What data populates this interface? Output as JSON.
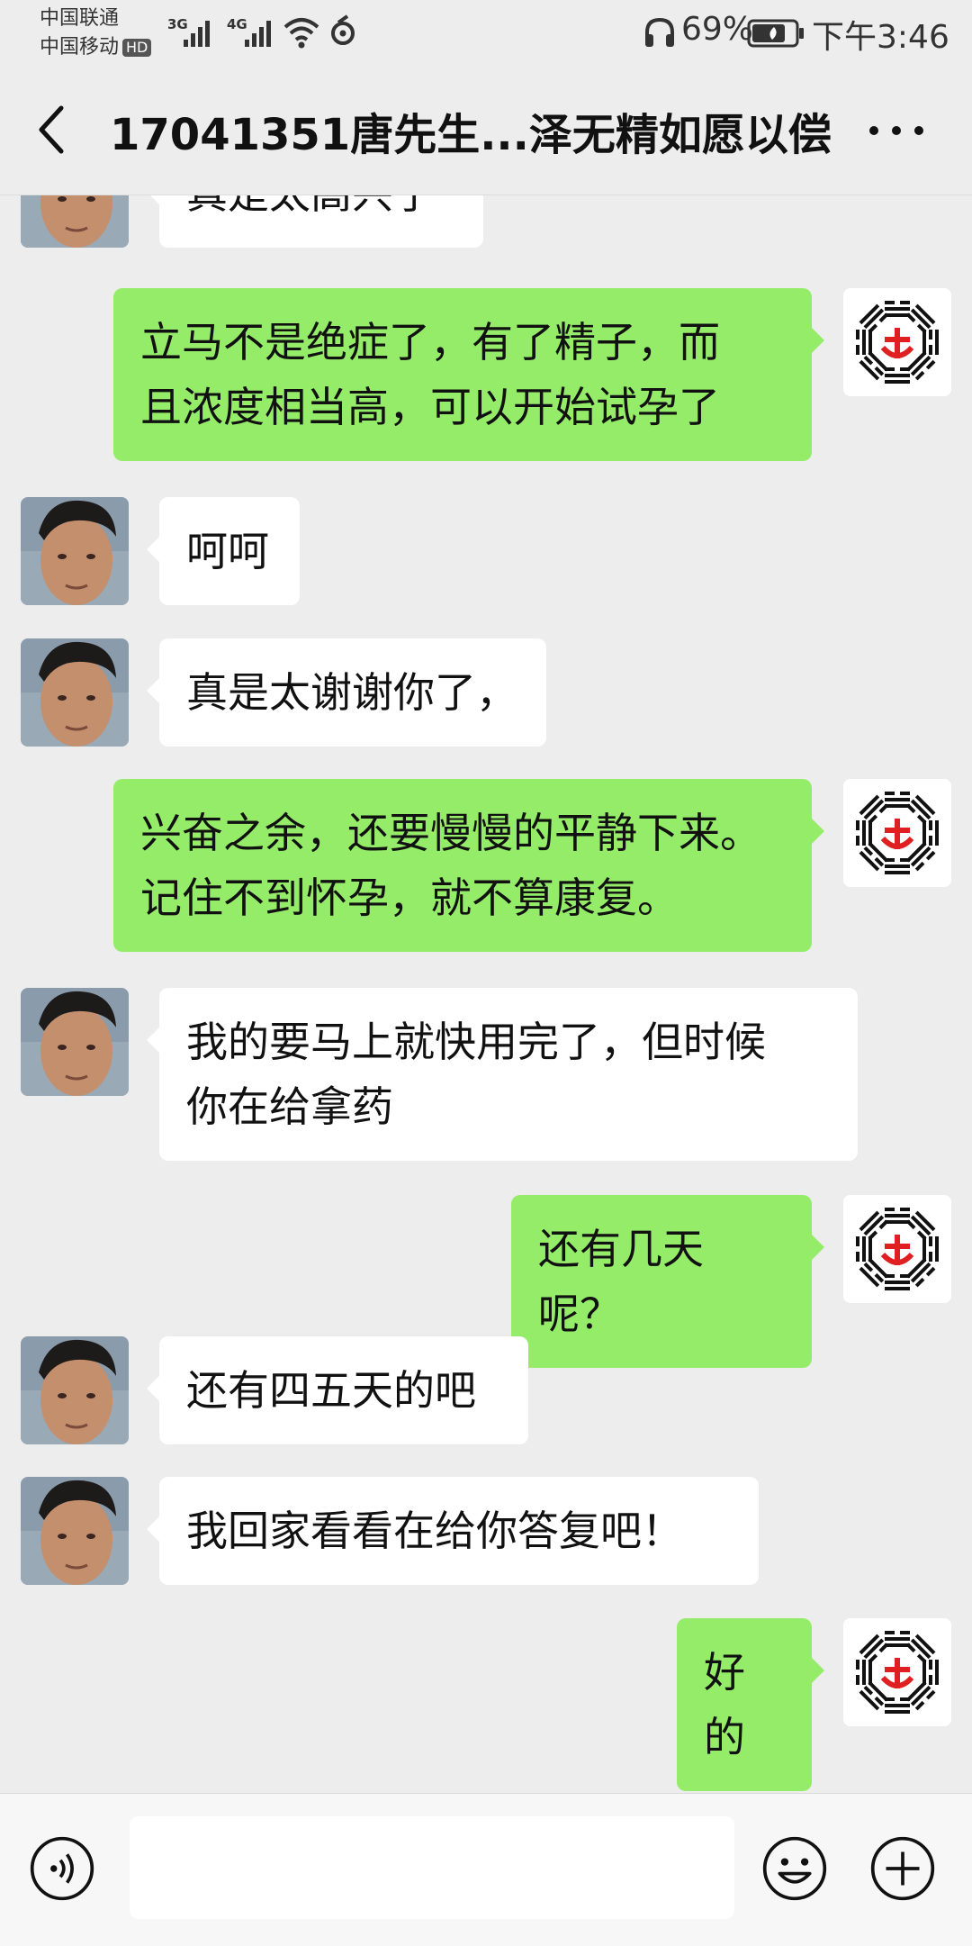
{
  "status_bar": {
    "carrier_1": "中国联通",
    "carrier_2": "中国移动",
    "hd_badge": "HD",
    "network_1": "3G",
    "network_2": "4G",
    "battery_percent": "69%",
    "time": "下午3:46"
  },
  "header": {
    "title": "17041351唐先生...泽无精如愿以偿"
  },
  "messages": [
    {
      "side": "left",
      "text": "真是太高兴了"
    },
    {
      "side": "right",
      "lines": [
        "立马不是绝症了，有了精子，而",
        "且浓度相当高，可以开始试孕了"
      ]
    },
    {
      "side": "left",
      "text": "呵呵"
    },
    {
      "side": "left",
      "text": "真是太谢谢你了，"
    },
    {
      "side": "right",
      "lines": [
        "兴奋之余，还要慢慢的平静下来。",
        "记住不到怀孕，就不算康复。"
      ]
    },
    {
      "side": "left",
      "lines": [
        "我的要马上就快用完了，但时候",
        "你在给拿药"
      ]
    },
    {
      "side": "right",
      "text": "还有几天呢？"
    },
    {
      "side": "left",
      "text": "还有四五天的吧"
    },
    {
      "side": "left",
      "text": "我回家看看在给你答复吧！"
    },
    {
      "side": "right",
      "text": "好的"
    }
  ],
  "input_bar": {
    "voice_icon": "voice-icon",
    "emoji_icon": "emoji-icon",
    "plus_icon": "plus-icon"
  },
  "colors": {
    "background": "#ededed",
    "sent_bubble": "#95ec69",
    "received_bubble": "#ffffff"
  }
}
